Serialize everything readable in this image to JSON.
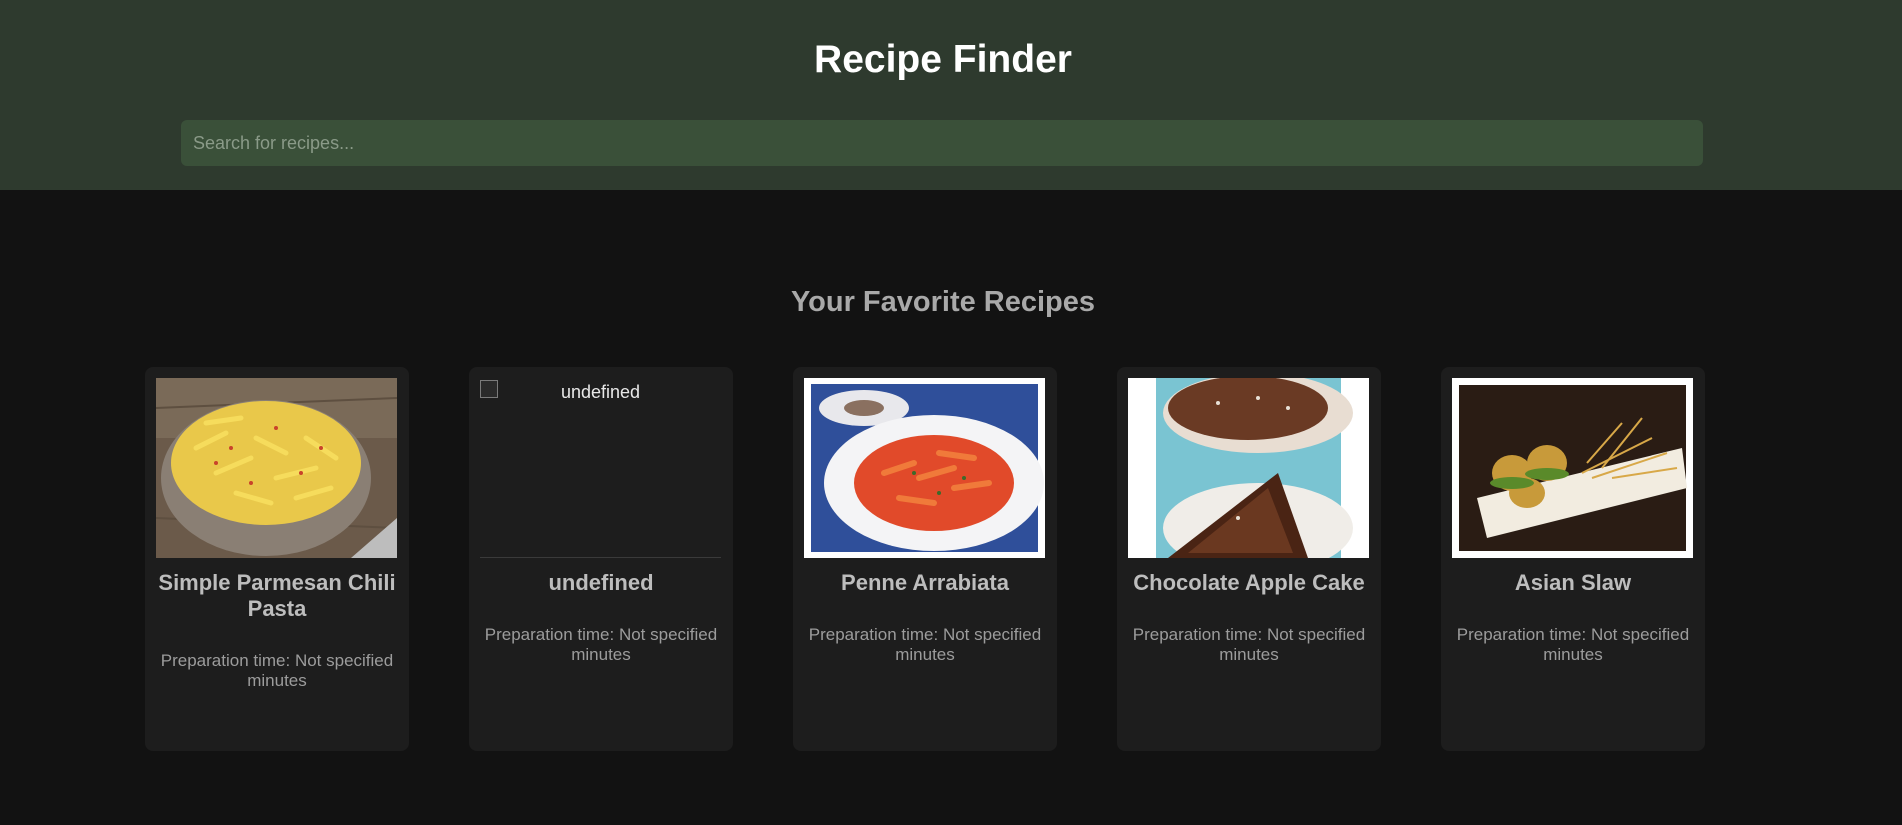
{
  "header": {
    "title": "Recipe Finder",
    "search_placeholder": "Search for recipes...",
    "search_value": ""
  },
  "favorites": {
    "title": "Your Favorite Recipes",
    "recipes": [
      {
        "name": "Simple Parmesan Chili Pasta",
        "time": "Preparation time: Not specified minutes",
        "image": "pasta-bowl-photo"
      },
      {
        "name": "undefined",
        "time": "Preparation time: Not specified minutes",
        "image_alt": "undefined",
        "image": "broken-image-icon"
      },
      {
        "name": "Penne Arrabiata",
        "time": "Preparation time: Not specified minutes",
        "image": "penne-plate-photo"
      },
      {
        "name": "Chocolate Apple Cake",
        "time": "Preparation time: Not specified minutes",
        "image": "chocolate-cake-photo"
      },
      {
        "name": "Asian Slaw",
        "time": "Preparation time: Not specified minutes",
        "image": "slaw-plate-photo"
      }
    ]
  },
  "colors": {
    "header_bg": "#2e3a2e",
    "search_bg": "#3a5039",
    "page_bg": "#121212",
    "card_bg": "#1d1d1d"
  }
}
